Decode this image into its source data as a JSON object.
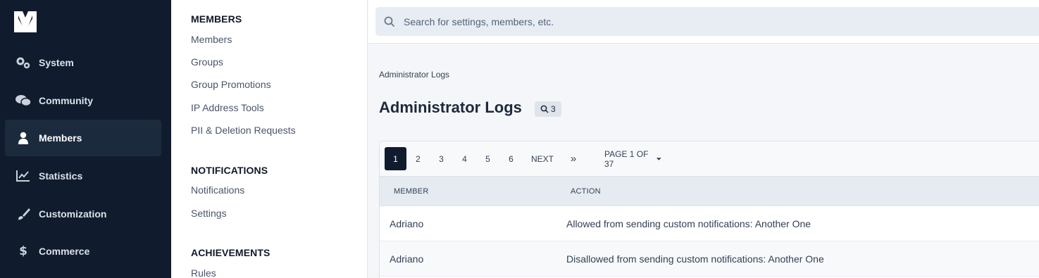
{
  "nav": {
    "items": [
      {
        "label": "System",
        "icon": "gears-icon"
      },
      {
        "label": "Community",
        "icon": "comments-icon"
      },
      {
        "label": "Members",
        "icon": "user-icon",
        "active": true
      },
      {
        "label": "Statistics",
        "icon": "chart-line-icon"
      },
      {
        "label": "Customization",
        "icon": "paintbrush-icon"
      },
      {
        "label": "Commerce",
        "icon": "dollar-icon"
      }
    ]
  },
  "submenu": {
    "sections": [
      {
        "heading": "MEMBERS",
        "links": [
          "Members",
          "Groups",
          "Group Promotions",
          "IP Address Tools",
          "PII & Deletion Requests"
        ]
      },
      {
        "heading": "NOTIFICATIONS",
        "links": [
          "Notifications",
          "Settings"
        ]
      },
      {
        "heading": "ACHIEVEMENTS",
        "links": [
          "Rules"
        ]
      }
    ]
  },
  "search": {
    "placeholder": "Search for settings, members, etc."
  },
  "breadcrumb": "Administrator Logs",
  "page": {
    "title": "Administrator Logs",
    "badge_count": "3"
  },
  "pagination": {
    "pages": [
      "1",
      "2",
      "3",
      "4",
      "5",
      "6"
    ],
    "active_page": "1",
    "next_label": "NEXT",
    "last_label": "»",
    "page_of": "PAGE 1 OF 37"
  },
  "table": {
    "columns": [
      "MEMBER",
      "ACTION"
    ],
    "rows": [
      {
        "member": "Adriano",
        "action": "Allowed from sending custom notifications: Another One"
      },
      {
        "member": "Adriano",
        "action": "Disallowed from sending custom notifications: Another One"
      }
    ]
  },
  "colors": {
    "nav_bg": "#101c2d",
    "active_nav": "#1c2a3e",
    "accent": "#101c2d"
  }
}
